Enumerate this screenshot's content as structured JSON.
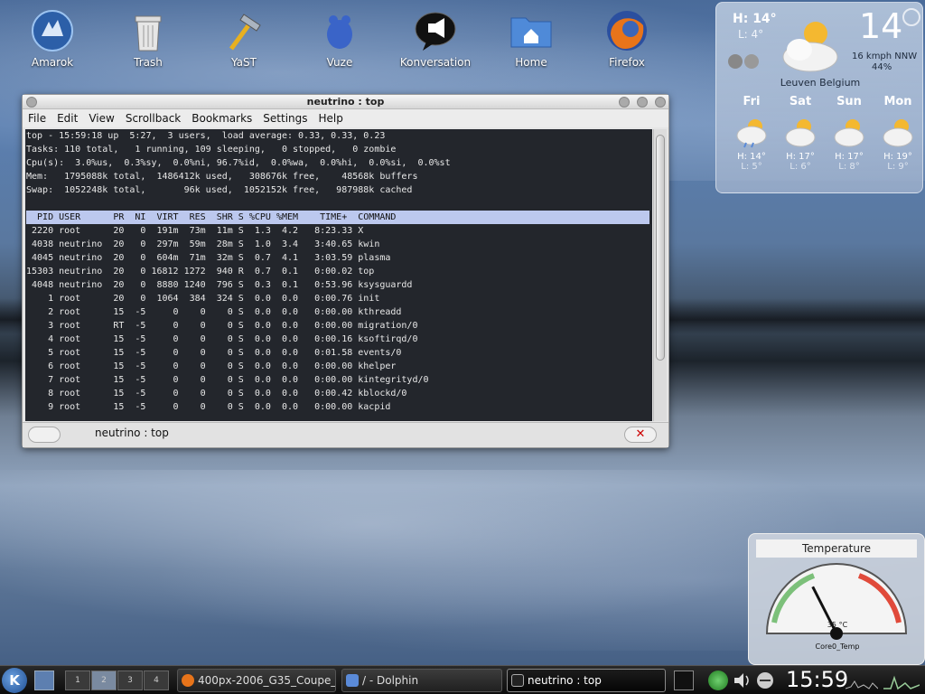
{
  "desktop": {
    "icons": [
      {
        "label": "Amarok",
        "icon": "wolf-icon"
      },
      {
        "label": "Trash",
        "icon": "trash-icon"
      },
      {
        "label": "YaST",
        "icon": "hammer-icon"
      },
      {
        "label": "Vuze",
        "icon": "frog-icon"
      },
      {
        "label": "Konversation",
        "icon": "speech-bubble-icon"
      },
      {
        "label": "Home",
        "icon": "home-folder-icon"
      },
      {
        "label": "Firefox",
        "icon": "firefox-icon"
      }
    ]
  },
  "weather": {
    "high": "H: 14°",
    "low": "L: 4°",
    "temp": "14",
    "wind": "16 kmph NNW",
    "humidity": "44%",
    "location": "Leuven Belgium",
    "forecast": [
      {
        "day": "Fri",
        "high": "H: 14°",
        "low": "L: 5°"
      },
      {
        "day": "Sat",
        "high": "H: 17°",
        "low": "L: 6°"
      },
      {
        "day": "Sun",
        "high": "H: 17°",
        "low": "L: 8°"
      },
      {
        "day": "Mon",
        "high": "H: 19°",
        "low": "L: 9°"
      }
    ]
  },
  "terminal": {
    "title": "neutrino : top",
    "menu": [
      "File",
      "Edit",
      "View",
      "Scrollback",
      "Bookmarks",
      "Settings",
      "Help"
    ],
    "summary": [
      "top - 15:59:18 up  5:27,  3 users,  load average: 0.33, 0.33, 0.23",
      "Tasks: 110 total,   1 running, 109 sleeping,   0 stopped,   0 zombie",
      "Cpu(s):  3.0%us,  0.3%sy,  0.0%ni, 96.7%id,  0.0%wa,  0.0%hi,  0.0%si,  0.0%st",
      "Mem:   1795088k total,  1486412k used,   308676k free,    48568k buffers",
      "Swap:  1052248k total,       96k used,  1052152k free,   987988k cached"
    ],
    "header": "  PID USER      PR  NI  VIRT  RES  SHR S %CPU %MEM    TIME+  COMMAND",
    "processes": [
      " 2220 root      20   0  191m  73m  11m S  1.3  4.2   8:23.33 X",
      " 4038 neutrino  20   0  297m  59m  28m S  1.0  3.4   3:40.65 kwin",
      " 4045 neutrino  20   0  604m  71m  32m S  0.7  4.1   3:03.59 plasma",
      "15303 neutrino  20   0 16812 1272  940 R  0.7  0.1   0:00.02 top",
      " 4048 neutrino  20   0  8880 1240  796 S  0.3  0.1   0:53.96 ksysguardd",
      "    1 root      20   0  1064  384  324 S  0.0  0.0   0:00.76 init",
      "    2 root      15  -5     0    0    0 S  0.0  0.0   0:00.00 kthreadd",
      "    3 root      RT  -5     0    0    0 S  0.0  0.0   0:00.00 migration/0",
      "    4 root      15  -5     0    0    0 S  0.0  0.0   0:00.16 ksoftirqd/0",
      "    5 root      15  -5     0    0    0 S  0.0  0.0   0:01.58 events/0",
      "    6 root      15  -5     0    0    0 S  0.0  0.0   0:00.00 khelper",
      "    7 root      15  -5     0    0    0 S  0.0  0.0   0:00.00 kintegrityd/0",
      "    8 root      15  -5     0    0    0 S  0.0  0.0   0:00.42 kblockd/0",
      "    9 root      15  -5     0    0    0 S  0.0  0.0   0:00.00 kacpid"
    ],
    "tab_label": "neutrino : top"
  },
  "temperature_widget": {
    "title": "Temperature",
    "value": "35 °C",
    "reading": 35,
    "sensor": "Core0_Temp"
  },
  "taskbar": {
    "k_menu": "K",
    "pagers": [
      "1",
      "2",
      "3",
      "4"
    ],
    "active_pager": 2,
    "tasks": [
      {
        "label": "400px-2006_G35_Coupe_",
        "icon": "firefox-icon"
      },
      {
        "label": "/ - Dolphin",
        "icon": "dolphin-icon"
      },
      {
        "label": "neutrino : top",
        "icon": "terminal-icon"
      }
    ],
    "clock": "15:59"
  }
}
